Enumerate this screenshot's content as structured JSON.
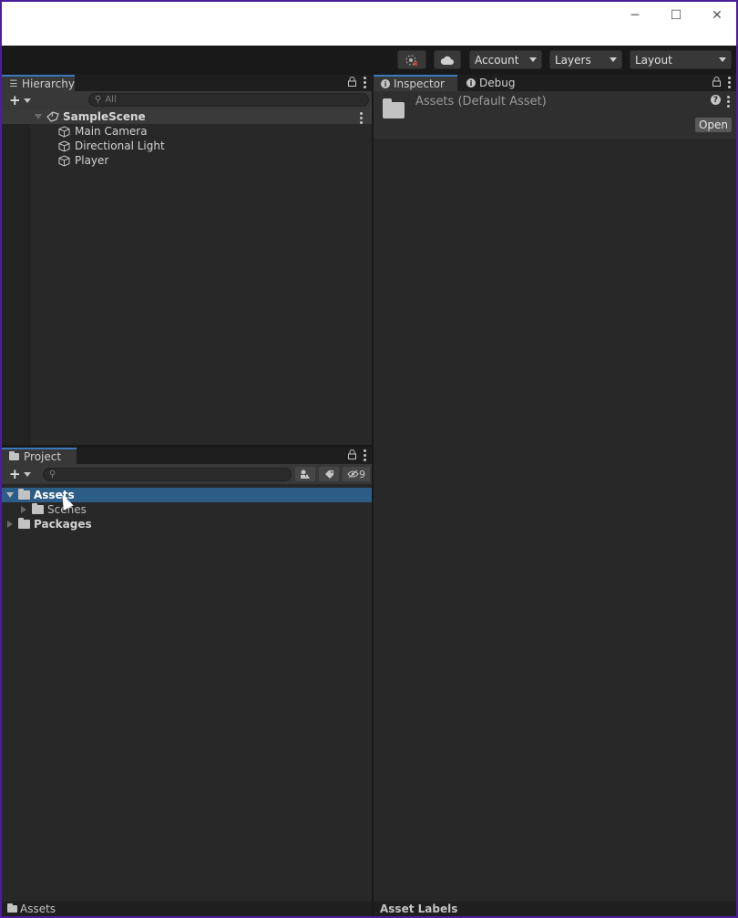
{
  "window": {
    "minimize_glyph": "─",
    "maximize_glyph": "☐",
    "close_glyph": "✕"
  },
  "toolbar": {
    "account_label": "Account",
    "layers_label": "Layers",
    "layout_label": "Layout",
    "collab_icon": "collab-icon",
    "cloud_icon": "cloud-icon"
  },
  "hierarchy": {
    "tab_label": "Hierarchy",
    "search_placeholder": "All",
    "scene": "SampleScene",
    "objects": [
      "Main Camera",
      "Directional Light",
      "Player"
    ]
  },
  "project": {
    "tab_label": "Project",
    "hidden_count": "9",
    "tree": {
      "assets": "Assets",
      "scenes": "Scenes",
      "packages": "Packages"
    },
    "status_path": "Assets"
  },
  "inspector": {
    "tab_inspector": "Inspector",
    "tab_debug": "Debug",
    "title": "Assets (Default Asset)",
    "open_label": "Open",
    "help_glyph": "?",
    "asset_labels": "Asset Labels"
  }
}
